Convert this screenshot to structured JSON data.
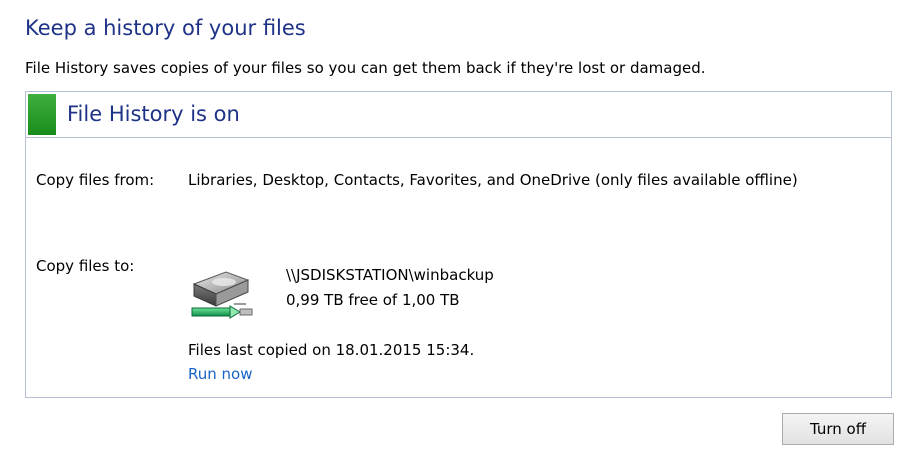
{
  "page": {
    "title": "Keep a history of your files",
    "description": "File History saves copies of your files so you can get them back if they're lost or damaged."
  },
  "status": {
    "title": "File History is on",
    "color": "#2ea02e"
  },
  "copy_from": {
    "label": "Copy files from:",
    "value": "Libraries, Desktop, Contacts, Favorites, and OneDrive (only files available offline)"
  },
  "copy_to": {
    "label": "Copy files to:",
    "drive_icon": "network-drive-icon",
    "drive_name": "\\\\JSDISKSTATION\\winbackup",
    "drive_space": "0,99 TB free of 1,00 TB"
  },
  "last_copied": "Files last copied on 18.01.2015 15:34.",
  "run_now_label": "Run now",
  "turn_off_label": "Turn off",
  "colors": {
    "heading": "#1e3287",
    "link": "#1a64c8",
    "border": "#b7bfd3"
  }
}
